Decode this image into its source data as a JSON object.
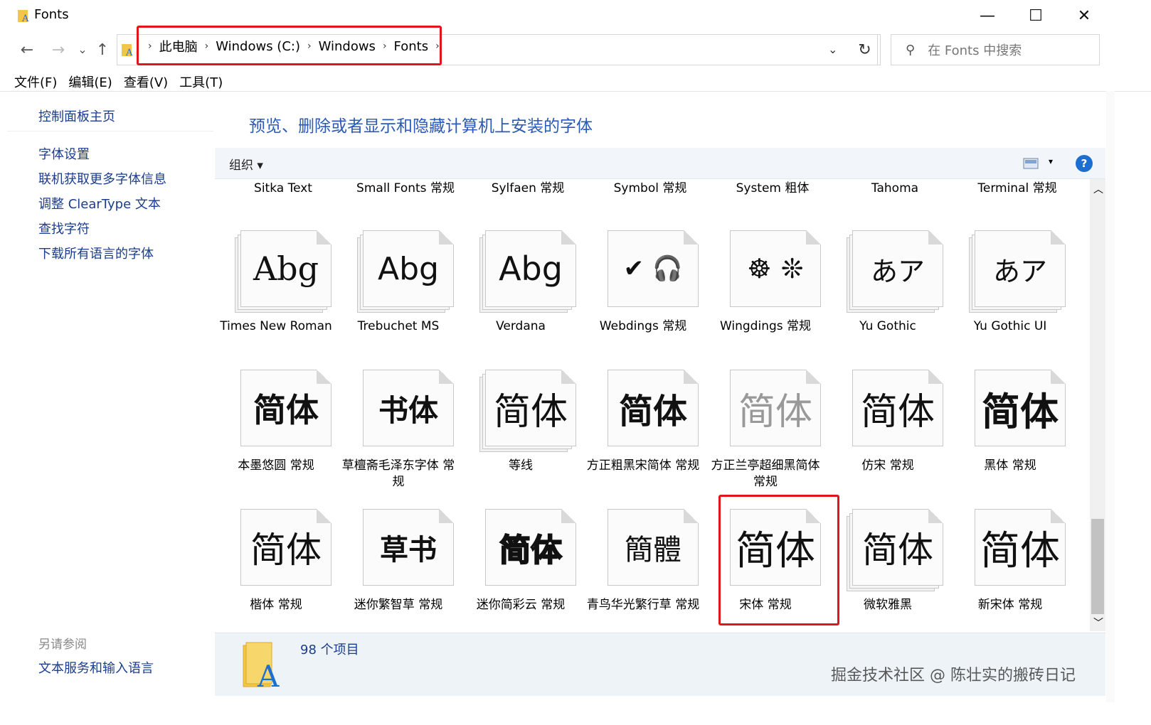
{
  "window": {
    "title": "Fonts",
    "controls": {
      "minimize": "—",
      "maximize": "☐",
      "close": "✕"
    }
  },
  "nav": {
    "back": "←",
    "forward": "→",
    "recent": "⌄",
    "up": "↑"
  },
  "breadcrumbs": [
    "此电脑",
    "Windows (C:)",
    "Windows",
    "Fonts"
  ],
  "search": {
    "placeholder": "在 Fonts 中搜索"
  },
  "menu": [
    "文件(F)",
    "编辑(E)",
    "查看(V)",
    "工具(T)"
  ],
  "left_pane": {
    "home": "控制面板主页",
    "links": [
      "字体设置",
      "联机获取更多字体信息",
      "调整 ClearType 文本",
      "查找字符",
      "下载所有语言的字体"
    ],
    "see_also_title": "另请参阅",
    "see_also": [
      "文本服务和输入语言"
    ]
  },
  "heading": "预览、删除或者显示和隐藏计算机上安装的字体",
  "toolbar": {
    "organize": "组织 ▾",
    "help": "?"
  },
  "top_row_labels": [
    "Sitka Text",
    "Small Fonts 常规",
    "Sylfaen 常规",
    "Symbol 常规",
    "System 粗体",
    "Tahoma",
    "Terminal 常规"
  ],
  "fonts": [
    {
      "name": "Times New Roman",
      "preview": "Abg"
    },
    {
      "name": "Trebuchet MS",
      "preview": "Abg"
    },
    {
      "name": "Verdana",
      "preview": "Abg"
    },
    {
      "name": "Webdings 常规",
      "preview": "✔ 🎧"
    },
    {
      "name": "Wingdings 常规",
      "preview": "☸ ❊"
    },
    {
      "name": "Yu Gothic",
      "preview": "あア"
    },
    {
      "name": "Yu Gothic UI",
      "preview": "あア"
    },
    {
      "name": "本墨悠圆 常规",
      "preview": "简体"
    },
    {
      "name": "草檀斋毛泽东字体 常规",
      "preview": "书体"
    },
    {
      "name": "等线",
      "preview": "简体"
    },
    {
      "name": "方正粗黑宋简体 常规",
      "preview": "简体"
    },
    {
      "name": "方正兰亭超细黑简体 常规",
      "preview": "简体"
    },
    {
      "name": "仿宋 常规",
      "preview": "简体"
    },
    {
      "name": "黑体 常规",
      "preview": "简体"
    },
    {
      "name": "楷体 常规",
      "preview": "简体"
    },
    {
      "name": "迷你繁智草 常规",
      "preview": "草书"
    },
    {
      "name": "迷你简彩云 常规",
      "preview": "简体"
    },
    {
      "name": "青鸟华光繁行草 常规",
      "preview": "簡體"
    },
    {
      "name": "宋体 常规",
      "preview": "简体"
    },
    {
      "name": "微软雅黑",
      "preview": "简体"
    },
    {
      "name": "新宋体 常规",
      "preview": "简体"
    }
  ],
  "status": {
    "count": "98 个项目"
  },
  "watermark": "掘金技术社区 @ 陈壮实的搬砖日记",
  "colors": {
    "highlight": "#e0161c",
    "link": "#1a3d8c",
    "heading": "#2a5ab6",
    "help": "#1c6ed0"
  }
}
